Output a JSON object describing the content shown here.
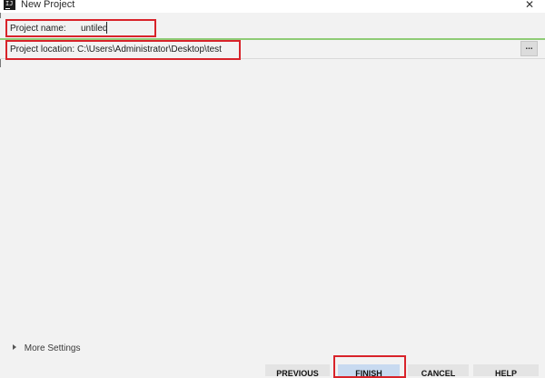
{
  "window": {
    "title": "New Project",
    "app_icon_text": "IJ",
    "close_glyph": "✕"
  },
  "form": {
    "project_name": {
      "label": "Project name:",
      "value": "untiled"
    },
    "project_location": {
      "label": "Project location:",
      "value": "C:\\Users\\Administrator\\Desktop\\test",
      "browse_label": "..."
    }
  },
  "more_settings": {
    "label": "More Settings",
    "icon": "triangle-right-icon"
  },
  "buttons": {
    "previous": "PREVIOUS",
    "finish": "FINISH",
    "cancel": "CANCEL",
    "help": "HELP"
  },
  "colors": {
    "highlight": "#d8232a",
    "focus_underline": "#8fcc76",
    "default_button": "#c8daf0"
  }
}
